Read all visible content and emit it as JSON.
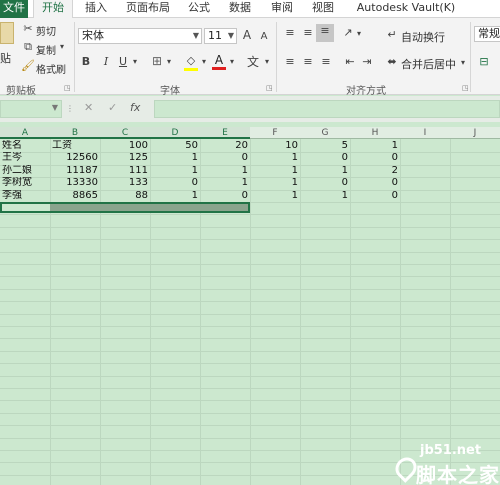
{
  "tabs": {
    "file": "文件",
    "home": "开始",
    "insert": "插入",
    "page_layout": "页面布局",
    "formulas": "公式",
    "data": "数据",
    "review": "审阅",
    "view": "视图",
    "vault": "Autodesk Vault(K)"
  },
  "ribbon": {
    "clipboard": {
      "paste": "贴",
      "cut": "剪切",
      "copy": "复制",
      "format_painter": "格式刷",
      "label": "剪贴板"
    },
    "font": {
      "name": "宋体",
      "size": "11",
      "grow": "A",
      "shrink": "A",
      "bold": "B",
      "italic": "I",
      "underline": "U",
      "phonetic": "wén",
      "label": "字体"
    },
    "alignment": {
      "wrap_text": "自动换行",
      "merge_center": "合并后居中",
      "label": "对齐方式"
    },
    "number": {
      "format": "常规"
    }
  },
  "formula_bar": {
    "cancel": "✕",
    "enter": "✓",
    "fx": "fx"
  },
  "columns": [
    "A",
    "B",
    "C",
    "D",
    "E",
    "F",
    "G",
    "H",
    "I",
    "J"
  ],
  "rows": [
    [
      "姓名",
      "工资",
      "100",
      "50",
      "20",
      "10",
      "5",
      "1"
    ],
    [
      "王岑",
      "12560",
      "125",
      "1",
      "0",
      "1",
      "0",
      "0"
    ],
    [
      "孙二娘",
      "11187",
      "111",
      "1",
      "1",
      "1",
      "1",
      "2"
    ],
    [
      "李树宽",
      "13330",
      "133",
      "0",
      "1",
      "1",
      "0",
      "0"
    ],
    [
      "李强",
      "8865",
      "88",
      "1",
      "0",
      "1",
      "1",
      "0"
    ]
  ],
  "watermark": {
    "domain": "jb51.net",
    "brand": "脚本之家"
  },
  "colors": {
    "accent": "#217346",
    "grid_background": "#cce8cf"
  }
}
